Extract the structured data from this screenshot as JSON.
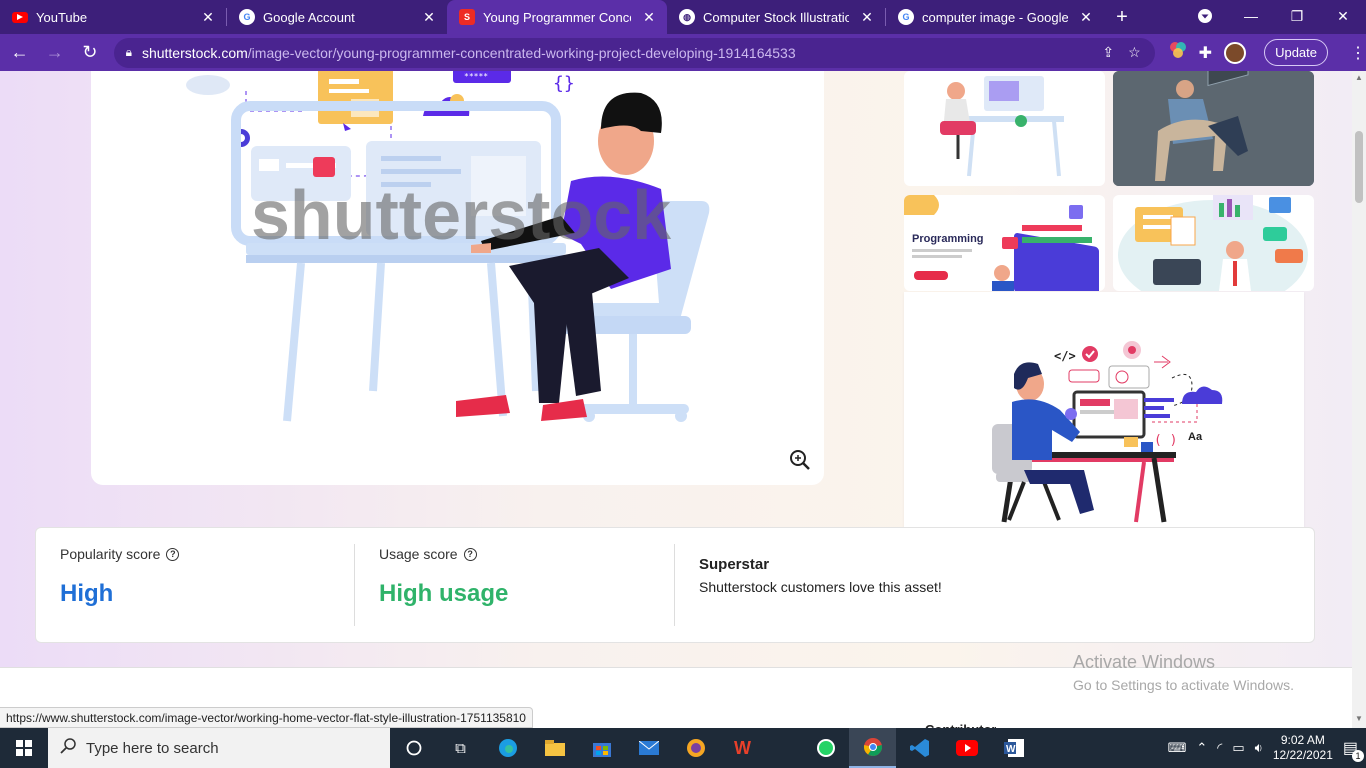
{
  "browser": {
    "tabs": [
      {
        "title": "YouTube",
        "icon": "youtube-icon"
      },
      {
        "title": "Google Account",
        "icon": "google-icon"
      },
      {
        "title": "Young Programmer Concentr",
        "icon": "shutterstock-icon"
      },
      {
        "title": "Computer Stock Illustrations,",
        "icon": "globe-icon"
      },
      {
        "title": "computer image - Google Se",
        "icon": "google-icon"
      }
    ],
    "url_host": "shutterstock.com",
    "url_path": "/image-vector/young-programmer-concentrated-working-project-developing-1914164533",
    "update_label": "Update"
  },
  "watermark": "shutterstock",
  "stats": {
    "popularity_label": "Popularity score",
    "popularity_value": "High",
    "usage_label": "Usage score",
    "usage_value": "High usage",
    "superstar_title": "Superstar",
    "superstar_text": "Shutterstock customers love this asset!"
  },
  "thumbnails": {
    "programming_label": "Programming"
  },
  "popup": {
    "code_tag": "</>",
    "aa_label": "Aa"
  },
  "activate": {
    "title": "Activate Windows",
    "subtitle": "Go to Settings to activate Windows."
  },
  "status_url": "https://www.shutterstock.com/image-vector/working-home-vector-flat-style-illustration-1751135810",
  "contributor_label": "Contributor",
  "taskbar": {
    "search_placeholder": "Type here to search",
    "time": "9:02 AM",
    "date": "12/22/2021",
    "notification_count": "1"
  },
  "colors": {
    "tab_bar": "#3d1f7a",
    "address_bar": "#5b2fa8",
    "popularity": "#1f6fd6",
    "usage": "#2fb36a",
    "shirt": "#5b2ae8"
  }
}
